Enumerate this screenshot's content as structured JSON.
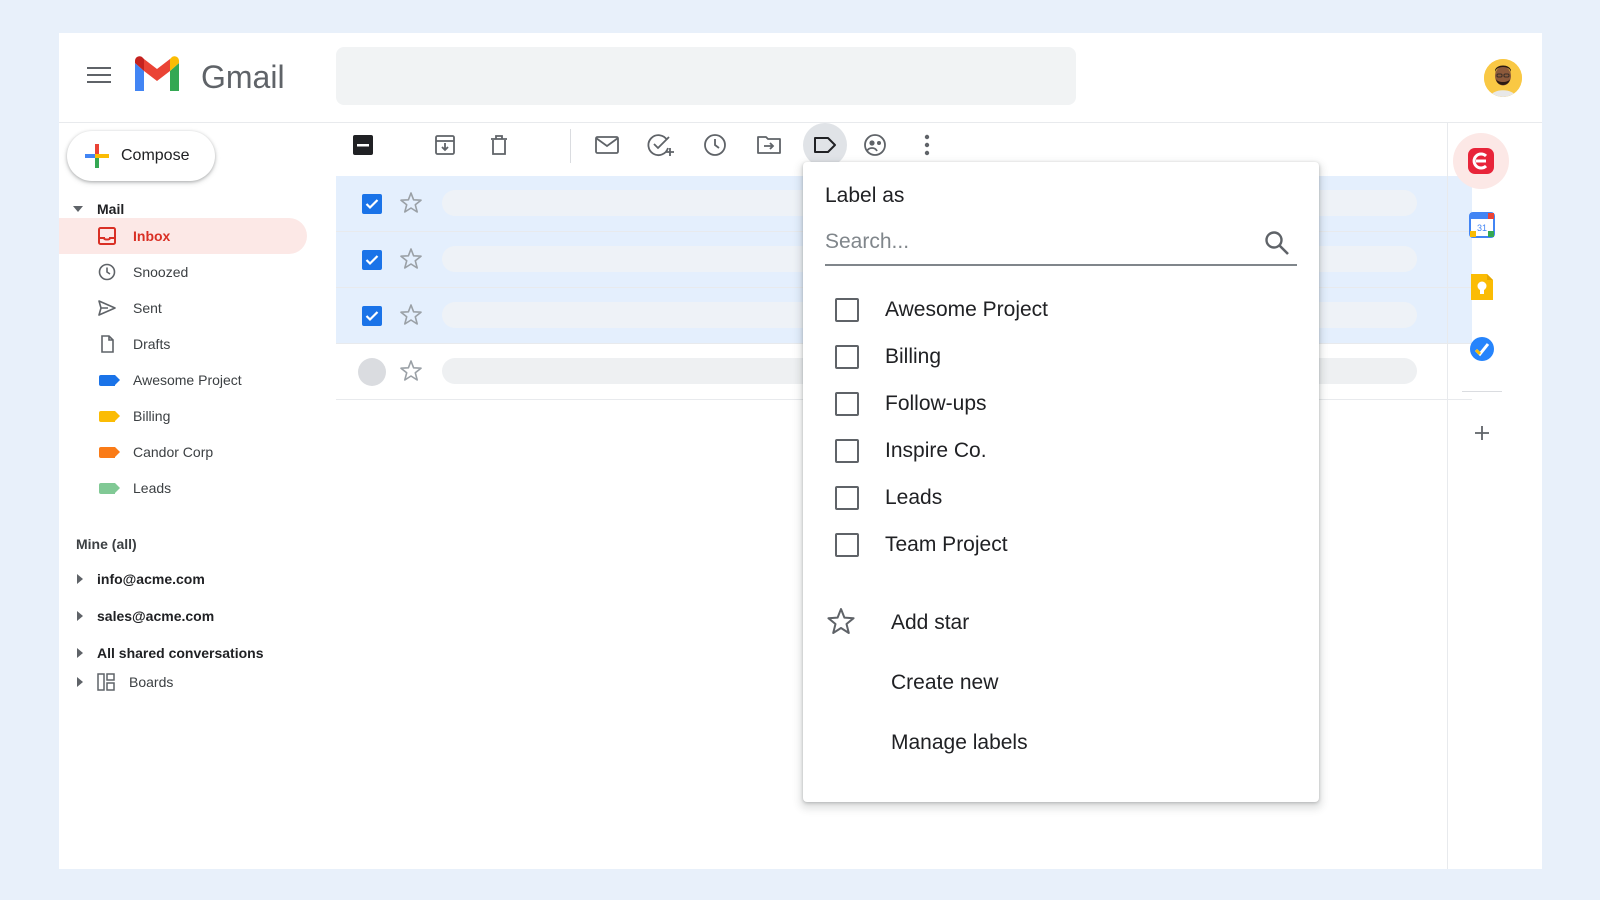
{
  "app": {
    "name": "Gmail"
  },
  "header": {
    "search_placeholder": "",
    "avatar_alt": "account-avatar"
  },
  "sidebar": {
    "compose_label": "Compose",
    "mail_section": "Mail",
    "items": [
      {
        "label": "Inbox",
        "icon": "inbox-icon",
        "active": true
      },
      {
        "label": "Snoozed",
        "icon": "clock-icon"
      },
      {
        "label": "Sent",
        "icon": "send-icon"
      },
      {
        "label": "Drafts",
        "icon": "draft-icon"
      },
      {
        "label": "Awesome Project",
        "icon": "label-icon",
        "color": "#1a73e8"
      },
      {
        "label": "Billing",
        "icon": "label-icon",
        "color": "#fbbc04"
      },
      {
        "label": "Candor Corp",
        "icon": "label-icon",
        "color": "#fa7b17"
      },
      {
        "label": "Leads",
        "icon": "label-icon",
        "color": "#81c995"
      }
    ],
    "mine_heading": "Mine (all)",
    "accounts": [
      "info@acme.com",
      "sales@acme.com",
      "All shared conversations"
    ],
    "boards_label": "Boards"
  },
  "toolbar": {
    "icons": [
      "deselect-icon",
      "archive-icon",
      "delete-icon",
      "mark-unread-icon",
      "add-task-icon",
      "snooze-icon",
      "move-to-icon",
      "label-icon",
      "assign-icon",
      "more-icon"
    ],
    "active": "label-icon"
  },
  "messages": [
    {
      "selected": true,
      "starred": false
    },
    {
      "selected": true,
      "starred": false
    },
    {
      "selected": true,
      "starred": false
    },
    {
      "selected": false,
      "starred": false
    }
  ],
  "label_menu": {
    "title": "Label as",
    "search_placeholder": "Search...",
    "labels": [
      {
        "name": "Awesome Project",
        "checked": false
      },
      {
        "name": "Billing",
        "checked": false
      },
      {
        "name": "Follow-ups",
        "checked": false
      },
      {
        "name": "Inspire Co.",
        "checked": false
      },
      {
        "name": "Leads",
        "checked": false
      },
      {
        "name": "Team Project",
        "checked": false
      }
    ],
    "actions": {
      "add_star": "Add star",
      "create_new": "Create new",
      "manage_labels": "Manage labels"
    }
  },
  "side_panel": {
    "apps": [
      "extension-icon",
      "calendar-icon",
      "keep-icon",
      "tasks-icon",
      "add-icon"
    ],
    "calendar_day": "31"
  },
  "colors": {
    "accent": "#1a73e8",
    "inbox_active": "#d93025",
    "selected_row": "#e4effd",
    "page_bg": "#e8f0fa"
  }
}
